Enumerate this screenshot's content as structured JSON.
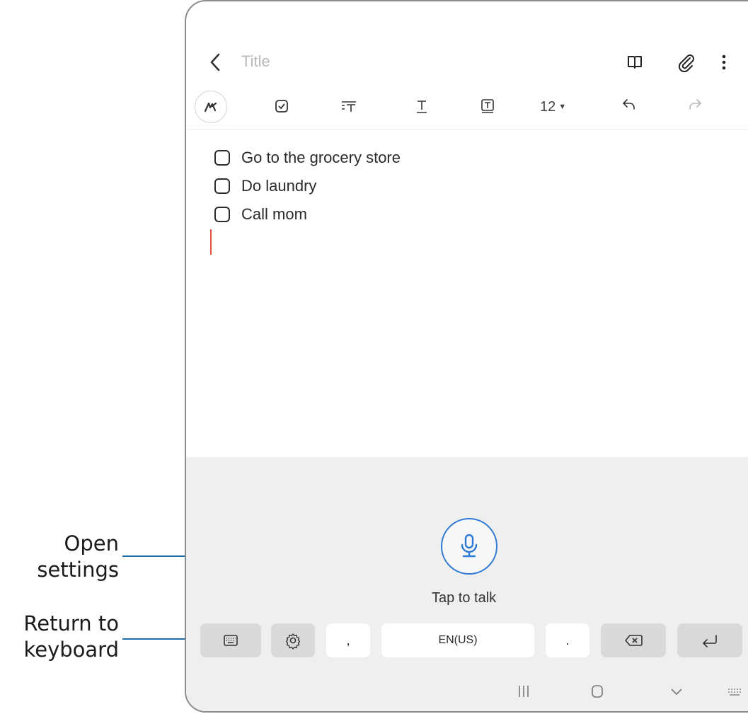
{
  "app": {
    "title_placeholder": "Title",
    "font_size": "12",
    "checklist": [
      {
        "label": "Go to the grocery store"
      },
      {
        "label": "Do laundry"
      },
      {
        "label": "Call mom"
      }
    ]
  },
  "voice_input": {
    "tap_to_talk": "Tap to talk",
    "language_key": "EN(US)",
    "comma_key": ",",
    "period_key": "."
  },
  "callouts": {
    "open_settings": "Open settings",
    "open_settings_line1": "Open",
    "open_settings_line2": "settings",
    "return_to_keyboard_line1": "Return to",
    "return_to_keyboard_line2": "keyboard"
  },
  "colors": {
    "accent": "#2c7ad6",
    "callout_line": "#1e6aa8",
    "cursor": "#e0553d",
    "panel_bg": "#efefef"
  },
  "icons": [
    "back-icon",
    "book-icon",
    "paperclip-icon",
    "more-vert-icon",
    "pen-icon",
    "checkbox-icon",
    "text-style-icon",
    "text-underline-icon",
    "text-box-icon",
    "undo-icon",
    "redo-icon",
    "mic-icon",
    "keyboard-icon",
    "gear-icon",
    "backspace-icon",
    "enter-icon",
    "recents-icon",
    "home-icon",
    "back-nav-icon",
    "keyboard-switch-icon"
  ]
}
